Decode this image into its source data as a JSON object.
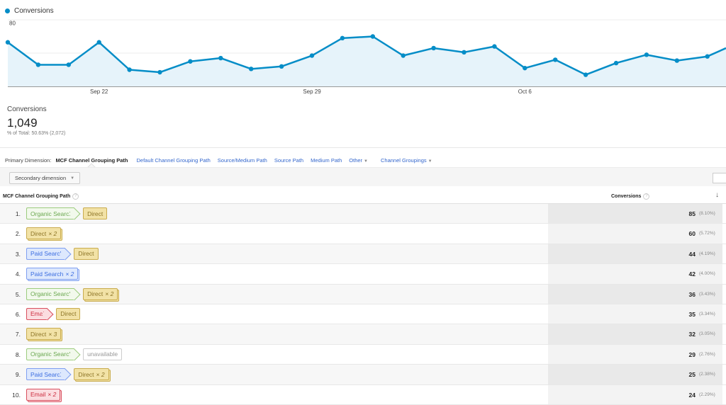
{
  "legend": {
    "label": "Conversions",
    "color": "#058dc7"
  },
  "chart_data": {
    "type": "area",
    "title": "",
    "series": [
      {
        "name": "Conversions",
        "color": "#058dc7",
        "values": [
          53,
          26,
          26,
          53,
          20,
          17,
          30,
          34,
          21,
          24,
          37,
          58,
          60,
          37,
          46,
          41,
          48,
          22,
          32,
          14,
          28,
          38,
          31,
          36,
          46
        ]
      }
    ],
    "x_tick_labels": [
      {
        "label": "Sep 22",
        "index": 3
      },
      {
        "label": "Sep 29",
        "index": 10
      },
      {
        "label": "Oct 6",
        "index": 17
      }
    ],
    "y_ticks": [
      40,
      80
    ],
    "ylim": [
      0,
      80
    ],
    "grid": true,
    "xlabel": "",
    "ylabel": ""
  },
  "summary": {
    "metric_name": "Conversions",
    "metric_value": "1,049",
    "metric_total": "% of Total: 50.63% (2,072)"
  },
  "primary_dimension": {
    "label": "Primary Dimension:",
    "active": "MCF Channel Grouping Path",
    "links": [
      "Default Channel Grouping Path",
      "Source/Medium Path",
      "Source Path",
      "Medium Path"
    ],
    "other": "Other",
    "channel_groupings": "Channel Groupings"
  },
  "toolbar": {
    "secondary_dimension": "Secondary dimension"
  },
  "table": {
    "col_path": "MCF Channel Grouping Path",
    "col_metric": "Conversions",
    "help_glyph": "?",
    "sort_glyph": "↓",
    "rows": [
      {
        "index": "1.",
        "value": "85",
        "pct": "(8.10%)",
        "steps": [
          {
            "channel": "organic",
            "label": "Organic Search",
            "mult": ""
          },
          {
            "channel": "direct",
            "label": "Direct",
            "mult": ""
          }
        ]
      },
      {
        "index": "2.",
        "value": "60",
        "pct": "(5.72%)",
        "steps": [
          {
            "channel": "direct",
            "label": "Direct",
            "mult": "× 2"
          }
        ]
      },
      {
        "index": "3.",
        "value": "44",
        "pct": "(4.19%)",
        "steps": [
          {
            "channel": "paid",
            "label": "Paid Search",
            "mult": ""
          },
          {
            "channel": "direct",
            "label": "Direct",
            "mult": ""
          }
        ]
      },
      {
        "index": "4.",
        "value": "42",
        "pct": "(4.00%)",
        "steps": [
          {
            "channel": "paid",
            "label": "Paid Search",
            "mult": "× 2"
          }
        ]
      },
      {
        "index": "5.",
        "value": "36",
        "pct": "(3.43%)",
        "steps": [
          {
            "channel": "organic",
            "label": "Organic Search",
            "mult": ""
          },
          {
            "channel": "direct",
            "label": "Direct",
            "mult": "× 2"
          }
        ]
      },
      {
        "index": "6.",
        "value": "35",
        "pct": "(3.34%)",
        "steps": [
          {
            "channel": "email",
            "label": "Email",
            "mult": ""
          },
          {
            "channel": "direct",
            "label": "Direct",
            "mult": ""
          }
        ]
      },
      {
        "index": "7.",
        "value": "32",
        "pct": "(3.05%)",
        "steps": [
          {
            "channel": "direct",
            "label": "Direct",
            "mult": "× 3"
          }
        ]
      },
      {
        "index": "8.",
        "value": "29",
        "pct": "(2.76%)",
        "steps": [
          {
            "channel": "organic",
            "label": "Organic Search",
            "mult": ""
          },
          {
            "channel": "unavail",
            "label": "unavailable",
            "mult": ""
          }
        ]
      },
      {
        "index": "9.",
        "value": "25",
        "pct": "(2.38%)",
        "steps": [
          {
            "channel": "paid",
            "label": "Paid Search",
            "mult": ""
          },
          {
            "channel": "direct",
            "label": "Direct",
            "mult": "× 2"
          }
        ]
      },
      {
        "index": "10.",
        "value": "24",
        "pct": "(2.29%)",
        "steps": [
          {
            "channel": "email",
            "label": "Email",
            "mult": "× 2"
          }
        ]
      }
    ]
  }
}
